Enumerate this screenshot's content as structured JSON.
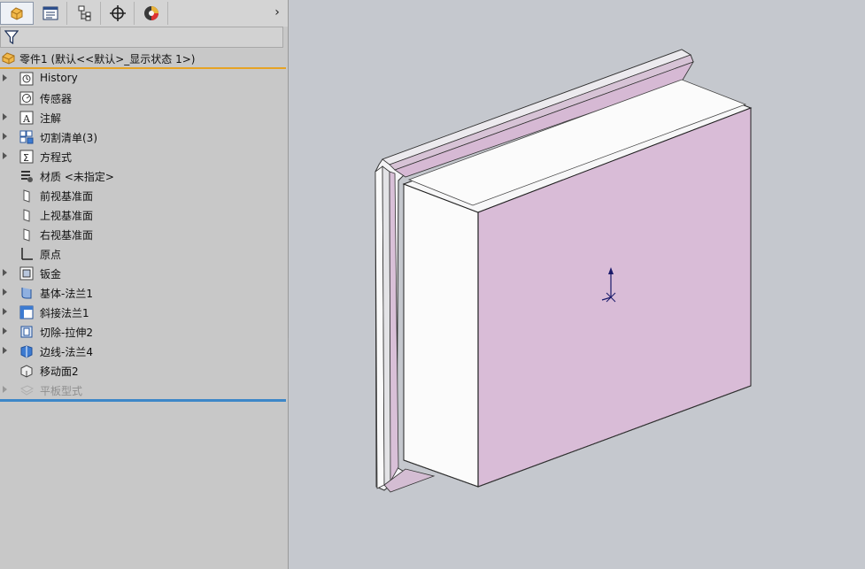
{
  "tabs": [
    {
      "name": "FeatureManager",
      "icon": "part-tree-icon"
    },
    {
      "name": "PropertyManager",
      "icon": "property-manager-icon"
    },
    {
      "name": "ConfigurationManager",
      "icon": "configuration-manager-icon"
    },
    {
      "name": "DimXpertManager",
      "icon": "dimxpert-icon"
    },
    {
      "name": "DisplayManager",
      "icon": "display-manager-icon"
    }
  ],
  "expand_glyph": "›",
  "root": {
    "label": "零件1  (默认<<默认>_显示状态 1>)",
    "icon": "part-icon"
  },
  "tree": [
    {
      "label": "History",
      "icon": "history-icon",
      "expandable": true,
      "disabled": false
    },
    {
      "label": "传感器",
      "icon": "sensor-icon",
      "expandable": false,
      "disabled": false
    },
    {
      "label": "注解",
      "icon": "annotation-icon",
      "expandable": true,
      "disabled": false
    },
    {
      "label": "切割清单(3)",
      "icon": "cut-list-icon",
      "expandable": true,
      "disabled": false
    },
    {
      "label": "方程式",
      "icon": "equation-icon",
      "expandable": true,
      "disabled": false
    },
    {
      "label": "材质 <未指定>",
      "icon": "material-icon",
      "expandable": false,
      "disabled": false
    },
    {
      "label": "前视基准面",
      "icon": "plane-icon",
      "expandable": false,
      "disabled": false
    },
    {
      "label": "上视基准面",
      "icon": "plane-icon",
      "expandable": false,
      "disabled": false
    },
    {
      "label": "右视基准面",
      "icon": "plane-icon",
      "expandable": false,
      "disabled": false
    },
    {
      "label": "原点",
      "icon": "origin-icon",
      "expandable": false,
      "disabled": false
    },
    {
      "label": "钣金",
      "icon": "sheet-metal-icon",
      "expandable": true,
      "disabled": false
    },
    {
      "label": "基体-法兰1",
      "icon": "base-flange-icon",
      "expandable": true,
      "disabled": false
    },
    {
      "label": "斜接法兰1",
      "icon": "miter-flange-icon",
      "expandable": true,
      "disabled": false
    },
    {
      "label": "切除-拉伸2",
      "icon": "cut-extrude-icon",
      "expandable": true,
      "disabled": false
    },
    {
      "label": "边线-法兰4",
      "icon": "edge-flange-icon",
      "expandable": true,
      "disabled": false
    },
    {
      "label": "移动面2",
      "icon": "move-face-icon",
      "expandable": false,
      "disabled": false
    },
    {
      "label": "平板型式",
      "icon": "flat-pattern-icon",
      "expandable": true,
      "disabled": true
    }
  ],
  "colors": {
    "accent": "#e6a323",
    "rollback": "#3d87c8",
    "face_pink": "#d9bcd7",
    "face_white": "#fbfbfb",
    "viewport_bg": "#c5c8ce"
  }
}
